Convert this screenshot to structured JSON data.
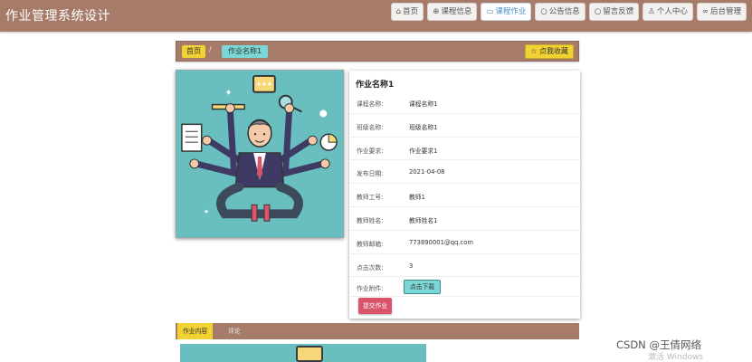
{
  "header": {
    "site_title": "作业管理系统设计",
    "nav": [
      {
        "label": "首页",
        "icon": "home-icon"
      },
      {
        "label": "课程信息",
        "icon": "globe-icon"
      },
      {
        "label": "课程作业",
        "icon": "book-icon"
      },
      {
        "label": "公告信息",
        "icon": "info-icon"
      },
      {
        "label": "留言反馈",
        "icon": "info-icon"
      },
      {
        "label": "个人中心",
        "icon": "user-icon"
      },
      {
        "label": "后台管理",
        "icon": "link-icon"
      }
    ],
    "active_nav": "课程作业"
  },
  "breadcrumb": {
    "home": "首页",
    "separator": "/",
    "current": "作业名称1",
    "favorite_label": "☆ 点我收藏"
  },
  "detail": {
    "title": "作业名称1",
    "rows": [
      {
        "label": "课程名称:",
        "value": "课程名称1"
      },
      {
        "label": "班级名称:",
        "value": "班级名称1"
      },
      {
        "label": "作业要求:",
        "value": "作业要求1"
      },
      {
        "label": "发布日期:",
        "value": "2021-04-08"
      },
      {
        "label": "教师工号:",
        "value": "教师1"
      },
      {
        "label": "教师姓名:",
        "value": "教师姓名1"
      },
      {
        "label": "教师邮箱:",
        "value": "773890001@qq.com"
      },
      {
        "label": "点击次数:",
        "value": "3"
      }
    ],
    "attachment_label": "作业附件:",
    "download_label": "点击下载",
    "submit_label": "提交作业"
  },
  "tabs": [
    {
      "label": "作业内容"
    },
    {
      "label": "评论"
    }
  ],
  "watermark": {
    "line1": "CSDN @王倩网络",
    "line2": "激活 Windows"
  },
  "colors": {
    "brand_brown": "#a67b69",
    "accent_yellow": "#f2d233",
    "accent_cyan": "#7ad7d5",
    "submit_red": "#d9536b",
    "illustration_teal": "#69bfc0"
  }
}
